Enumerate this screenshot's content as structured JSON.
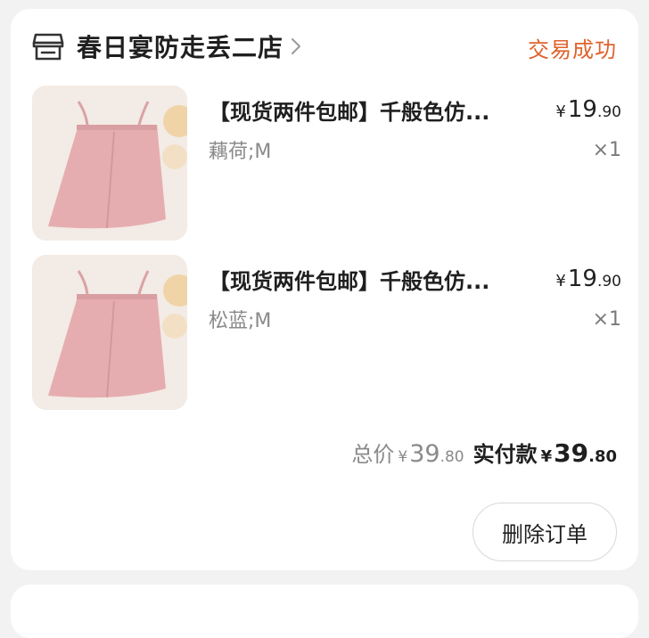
{
  "order": {
    "shop_name": "春日宴防走丢二店",
    "status": "交易成功",
    "shop_icon": "shop-icon",
    "items": [
      {
        "title": "【现货两件包邮】千般色仿...",
        "spec": "藕荷;M",
        "price_currency": "¥",
        "price_int": "19",
        "price_dec": ".90",
        "quantity": "×1",
        "thumb_color": "#e8b3b4"
      },
      {
        "title": "【现货两件包邮】千般色仿...",
        "spec": "松蓝;M",
        "price_currency": "¥",
        "price_int": "19",
        "price_dec": ".90",
        "quantity": "×1",
        "thumb_color": "#e8b3b4"
      }
    ],
    "total": {
      "label": "总价",
      "currency": "¥",
      "int": "39",
      "dec": ".80"
    },
    "paid": {
      "label": "实付款",
      "currency": "¥",
      "int": "39",
      "dec": ".80"
    },
    "delete_button": "删除订单"
  },
  "colors": {
    "status": "#e0622c",
    "card": "#ffffff",
    "background": "#f2f2f2"
  }
}
